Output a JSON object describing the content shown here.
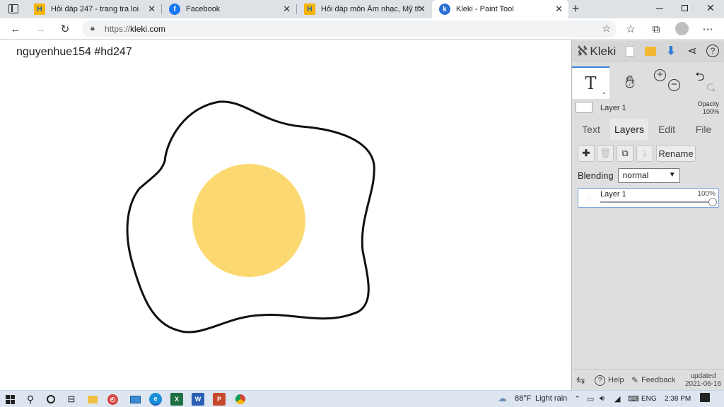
{
  "browser": {
    "tabs": [
      {
        "title": "Hỏi đáp 247 - trang tra loi",
        "favicon": "hd247-icon",
        "active": false
      },
      {
        "title": "Facebook",
        "favicon": "facebook-icon",
        "active": false
      },
      {
        "title": "Hỏi đáp môn Âm nhạc, Mỹ thuật",
        "favicon": "hd247-icon",
        "active": false
      },
      {
        "title": "Kleki - Paint Tool",
        "favicon": "kleki-icon",
        "active": true
      }
    ],
    "url_prefix": "https://",
    "url_host": "kleki.com",
    "new_tab_icon": "plus-icon"
  },
  "canvas": {
    "text": "nguyenhue154 #hd247",
    "yolk_color": "#fcd970",
    "outline_color": "#111111"
  },
  "kleki": {
    "logo": "Kleki",
    "layer_bar": {
      "name": "Layer 1",
      "opacity_label": "Opacity",
      "opacity_value": "100%"
    },
    "tabs": [
      "Text",
      "Layers",
      "Edit",
      "File"
    ],
    "active_tab": "Layers",
    "rename_label": "Rename",
    "blending_label": "Blending",
    "blending_value": "normal",
    "layers": [
      {
        "name": "Layer 1",
        "opacity": "100%"
      }
    ],
    "footer": {
      "help": "Help",
      "feedback": "Feedback",
      "updated_label": "updated",
      "updated_date": "2021-06-16"
    }
  },
  "taskbar": {
    "temperature": "88°F",
    "weather": "Light rain",
    "lang": "ENG",
    "time": "2:38 PM"
  }
}
